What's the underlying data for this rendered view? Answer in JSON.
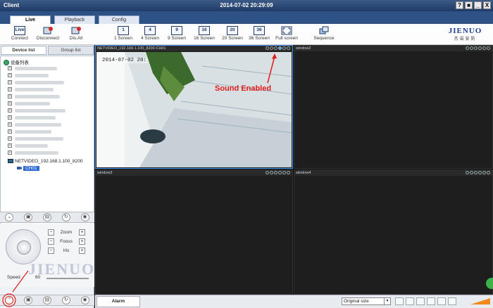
{
  "window": {
    "title": "Client",
    "datetime": "2014-07-02 20:29:09",
    "controls": [
      "?",
      "■",
      "_",
      "X"
    ]
  },
  "main_tabs": [
    "Live",
    "Playback",
    "Config"
  ],
  "toolbar": {
    "connect": "Connect",
    "disconnect": "Disconnect",
    "dis_all": "Dis.All",
    "layouts": [
      {
        "num": "1",
        "label": "1 Screen"
      },
      {
        "num": "4",
        "label": "4 Screen"
      },
      {
        "num": "9",
        "label": "9 Screen"
      },
      {
        "num": "16",
        "label": "16 Screen"
      },
      {
        "num": "20",
        "label": "20 Screen"
      },
      {
        "num": "36",
        "label": "36 Screen"
      }
    ],
    "fullscreen": "Full screen",
    "sequence": "Sequence",
    "live_badge": "Live"
  },
  "logo": {
    "brand": "JIENUO",
    "sub": "杰诺安防"
  },
  "left_panel": {
    "tabs": [
      "Device list",
      "Group list"
    ],
    "tree_root": "设备列表",
    "device": "NETVIDEO_192.168.1.100_8200",
    "channel": "CH01"
  },
  "ptz": {
    "zoom": "Zoom",
    "focus": "Focus",
    "iris": "Iris",
    "speed_label": "Speed",
    "speed_value": "60",
    "minus": "−",
    "plus": "+"
  },
  "watermark": "JIENUO",
  "windows": [
    {
      "title": "NETVIDEO_192.168.1.100_8200-CH01",
      "osd": "2014-07-02 20:"
    },
    {
      "title": "window2"
    },
    {
      "title": "window3"
    },
    {
      "title": "window4"
    }
  ],
  "annotation": "Sound Enabled",
  "bottom": {
    "alarm_tab": "Alarm",
    "size_select": "Original size"
  },
  "colors": {
    "titlebar": "#2f5286",
    "selected_window_border": "#4d9bff",
    "annotation": "#e01b1b"
  }
}
